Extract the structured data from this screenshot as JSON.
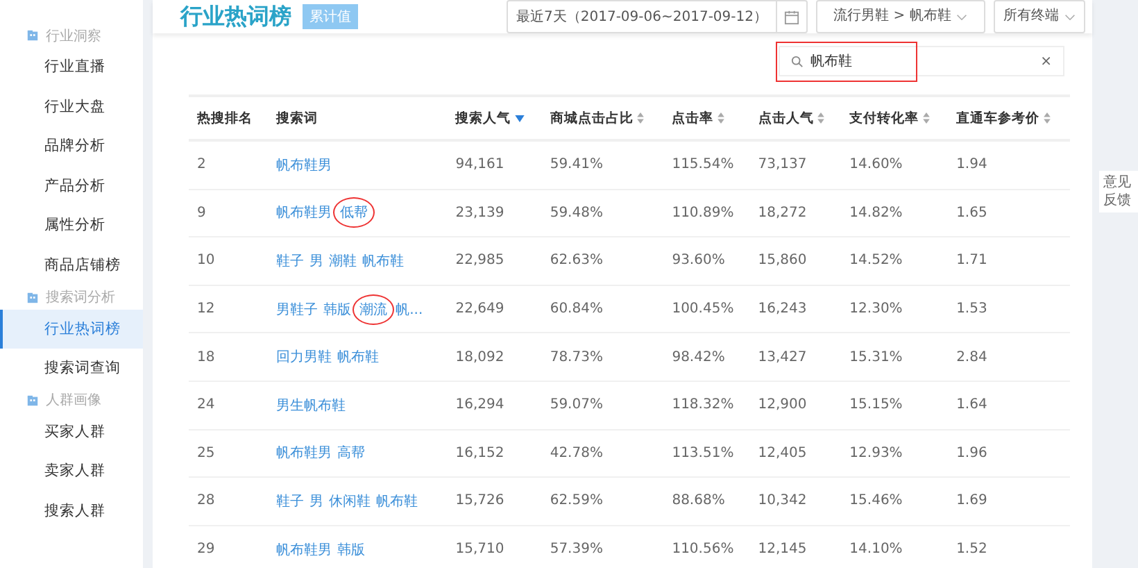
{
  "sidebar": {
    "groups": [
      {
        "title": "行业洞察",
        "items": [
          {
            "label": "行业直播",
            "selected": false
          },
          {
            "label": "行业大盘",
            "selected": false
          },
          {
            "label": "品牌分析",
            "selected": false
          },
          {
            "label": "产品分析",
            "selected": false
          },
          {
            "label": "属性分析",
            "selected": false
          },
          {
            "label": "商品店铺榜",
            "selected": false
          }
        ]
      },
      {
        "title": "搜索词分析",
        "items": [
          {
            "label": "行业热词榜",
            "selected": true
          },
          {
            "label": "搜索词查询",
            "selected": false
          }
        ]
      },
      {
        "title": "人群画像",
        "items": [
          {
            "label": "买家人群",
            "selected": false
          },
          {
            "label": "卖家人群",
            "selected": false
          },
          {
            "label": "搜索人群",
            "selected": false
          }
        ]
      }
    ]
  },
  "header": {
    "title": "行业热词榜",
    "tag": "累计值",
    "date_range": "最近7天（2017-09-06~2017-09-12）",
    "category": "流行男鞋 > 帆布鞋",
    "terminal": "所有终端"
  },
  "search": {
    "value": "帆布鞋",
    "clear": "×",
    "highlighted": true
  },
  "table": {
    "columns": [
      {
        "label": "热搜排名",
        "sortable": false
      },
      {
        "label": "搜索词",
        "sortable": false
      },
      {
        "label": "搜索人气",
        "sortable": true,
        "sorted": true
      },
      {
        "label": "商城点击占比",
        "sortable": true,
        "sorted": false
      },
      {
        "label": "点击率",
        "sortable": true,
        "sorted": false
      },
      {
        "label": "点击人气",
        "sortable": true,
        "sorted": false
      },
      {
        "label": "支付转化率",
        "sortable": true,
        "sorted": false
      },
      {
        "label": "直通车参考价",
        "sortable": true,
        "sorted": false
      }
    ],
    "rows": [
      {
        "cells": [
          "2",
          {
            "terms": [
              {
                "text": "帆布鞋男",
                "circled": false
              }
            ]
          },
          "94,161",
          "59.41%",
          "115.54%",
          "73,137",
          "14.60%",
          "1.94"
        ]
      },
      {
        "cells": [
          "9",
          {
            "terms": [
              {
                "text": "帆布鞋男",
                "circled": false
              },
              {
                "text": "低帮",
                "circled": true
              }
            ]
          },
          "23,139",
          "59.48%",
          "110.89%",
          "18,272",
          "14.82%",
          "1.65"
        ]
      },
      {
        "cells": [
          "10",
          {
            "terms": [
              {
                "text": "鞋子",
                "circled": false
              },
              {
                "text": "男",
                "circled": false
              },
              {
                "text": "潮鞋",
                "circled": false
              },
              {
                "text": "帆布鞋",
                "circled": false
              }
            ]
          },
          "22,985",
          "62.63%",
          "93.60%",
          "15,860",
          "14.52%",
          "1.71"
        ]
      },
      {
        "cells": [
          "12",
          {
            "terms": [
              {
                "text": "男鞋子",
                "circled": false
              },
              {
                "text": "韩版",
                "circled": false
              },
              {
                "text": "潮流",
                "circled": true
              },
              {
                "text": "帆...",
                "circled": false
              }
            ]
          },
          "22,649",
          "60.84%",
          "100.45%",
          "16,243",
          "12.30%",
          "1.53"
        ]
      },
      {
        "cells": [
          "18",
          {
            "terms": [
              {
                "text": "回力男鞋",
                "circled": false
              },
              {
                "text": "帆布鞋",
                "circled": false
              }
            ]
          },
          "18,092",
          "78.73%",
          "98.42%",
          "13,427",
          "15.31%",
          "2.84"
        ]
      },
      {
        "cells": [
          "24",
          {
            "terms": [
              {
                "text": "男生帆布鞋",
                "circled": false
              }
            ]
          },
          "16,294",
          "59.07%",
          "118.32%",
          "12,900",
          "15.15%",
          "1.64"
        ]
      },
      {
        "cells": [
          "25",
          {
            "terms": [
              {
                "text": "帆布鞋男",
                "circled": false
              },
              {
                "text": "高帮",
                "circled": false
              }
            ]
          },
          "16,152",
          "42.78%",
          "113.51%",
          "12,405",
          "12.93%",
          "1.96"
        ]
      },
      {
        "cells": [
          "28",
          {
            "terms": [
              {
                "text": "鞋子",
                "circled": false
              },
              {
                "text": "男",
                "circled": false
              },
              {
                "text": "休闲鞋",
                "circled": false
              },
              {
                "text": "帆布鞋",
                "circled": false
              }
            ]
          },
          "15,726",
          "62.59%",
          "88.68%",
          "10,342",
          "15.46%",
          "1.69"
        ]
      },
      {
        "cells": [
          "29",
          {
            "terms": [
              {
                "text": "帆布鞋男",
                "circled": false
              },
              {
                "text": "韩版",
                "circled": false
              }
            ]
          },
          "15,710",
          "57.39%",
          "110.56%",
          "12,145",
          "14.10%",
          "1.52"
        ]
      }
    ]
  },
  "feedback": "意见反馈"
}
